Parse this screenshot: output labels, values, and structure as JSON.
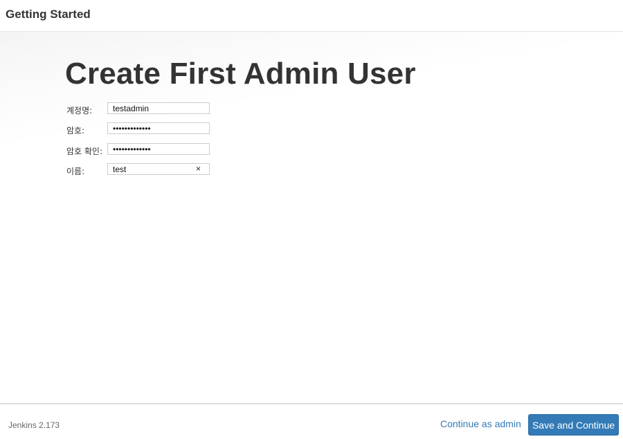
{
  "header": {
    "title": "Getting Started"
  },
  "main": {
    "heading": "Create First Admin User",
    "fields": [
      {
        "label": "계정명:",
        "value": "testadmin",
        "type": "text"
      },
      {
        "label": "암호:",
        "value": "•••••••••••••",
        "type": "password"
      },
      {
        "label": "암호 확인:",
        "value": "•••••••••••••",
        "type": "password"
      },
      {
        "label": "이름:",
        "value": "test",
        "type": "text",
        "clear_icon": "×"
      }
    ]
  },
  "footer": {
    "version": "Jenkins 2.173",
    "continue_label": "Continue as admin",
    "save_label": "Save and Continue"
  },
  "colors": {
    "accent": "#337ab7",
    "text": "#333333",
    "muted": "#666666"
  },
  "icons": {
    "clear": "close-icon"
  }
}
